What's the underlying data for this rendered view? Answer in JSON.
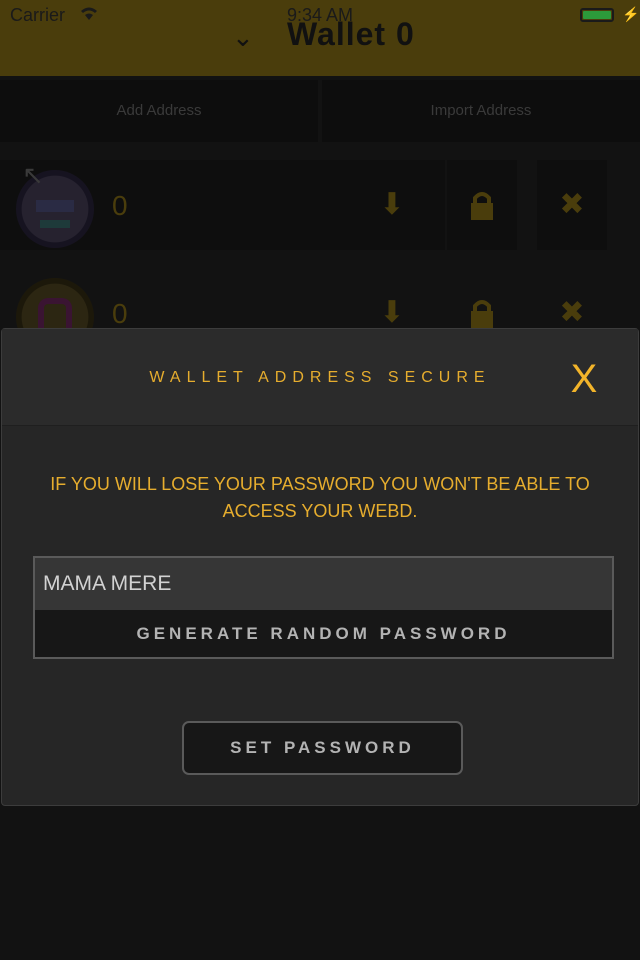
{
  "status_bar": {
    "carrier": "Carrier",
    "time": "9:34 AM",
    "battery_level": 1.0
  },
  "header": {
    "title": "Wallet 0",
    "chevron_icon": "chevron-down-icon",
    "background_color": "#f5c518"
  },
  "tabs": {
    "add_address": "Add Address",
    "import_address": "Import Address"
  },
  "addresses": [
    {
      "amount": "0",
      "icons": [
        "download-icon",
        "lock-icon",
        "remove-icon"
      ]
    },
    {
      "amount": "0",
      "icons": [
        "download-icon",
        "lock-icon",
        "remove-icon"
      ]
    }
  ],
  "modal": {
    "title": "WALLET ADDRESS SECURE",
    "close_label": "X",
    "warning": "IF YOU WILL LOSE YOUR PASSWORD YOU WON'T BE ABLE TO ACCESS YOUR WEBD.",
    "password_value": "MAMA MERE",
    "generate_label": "GENERATE RANDOM PASSWORD",
    "set_label": "SET PASSWORD",
    "accent_color": "#f2b42a"
  }
}
